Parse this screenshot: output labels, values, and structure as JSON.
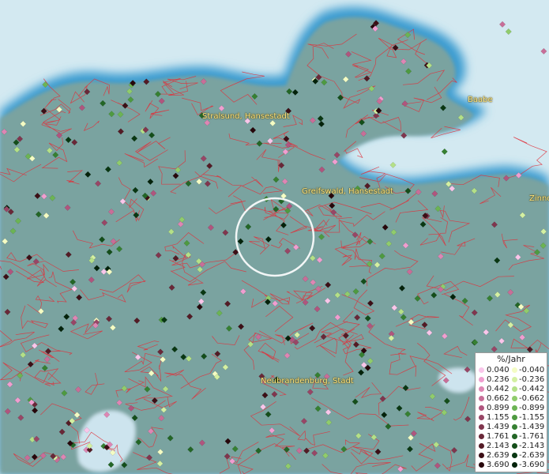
{
  "map": {
    "labels": [
      {
        "id": "stralsund",
        "text": "Stralsund, Hansestadt"
      },
      {
        "id": "greifswald",
        "text": "Greifswald, Hansestadt"
      },
      {
        "id": "neubrandenburg",
        "text": "Neubrandenburg, Stadt"
      },
      {
        "id": "baabe",
        "text": "Baabe"
      },
      {
        "id": "zinnowitz",
        "text": "Zinno"
      }
    ],
    "colors": {
      "sea": "#d3e9f1",
      "land": "#7aa3a0",
      "coast_blue": "#3a9bd0",
      "borders": "#e0303a",
      "label": "#ffe680"
    }
  },
  "legend": {
    "title": "%/Jahr",
    "positive": [
      {
        "value": "0.040",
        "color": "#f9c6ea"
      },
      {
        "value": "0.236",
        "color": "#f09ed0"
      },
      {
        "value": "0.442",
        "color": "#de86b4"
      },
      {
        "value": "0.662",
        "color": "#c86e98"
      },
      {
        "value": "0.899",
        "color": "#b0557e"
      },
      {
        "value": "1.155",
        "color": "#984666"
      },
      {
        "value": "1.439",
        "color": "#80364e"
      },
      {
        "value": "1.761",
        "color": "#692838"
      },
      {
        "value": "2.143",
        "color": "#531b25"
      },
      {
        "value": "2.639",
        "color": "#3c0f16"
      },
      {
        "value": "3.690",
        "color": "#27070b"
      }
    ],
    "negative": [
      {
        "value": "-0.040",
        "color": "#f4fcc4"
      },
      {
        "value": "-0.236",
        "color": "#d4f0a2"
      },
      {
        "value": "-0.442",
        "color": "#b4e088"
      },
      {
        "value": "-0.662",
        "color": "#90cc6c"
      },
      {
        "value": "-0.899",
        "color": "#6cb454"
      },
      {
        "value": "-1.155",
        "color": "#4e9a40"
      },
      {
        "value": "-1.439",
        "color": "#368032"
      },
      {
        "value": "-1.761",
        "color": "#236626"
      },
      {
        "value": "-2.143",
        "color": "#144e1a"
      },
      {
        "value": "-2.639",
        "color": "#093712"
      },
      {
        "value": "-3.690",
        "color": "#03220a"
      }
    ]
  },
  "selection": {
    "shape": "circle",
    "color": "#ffffff"
  }
}
